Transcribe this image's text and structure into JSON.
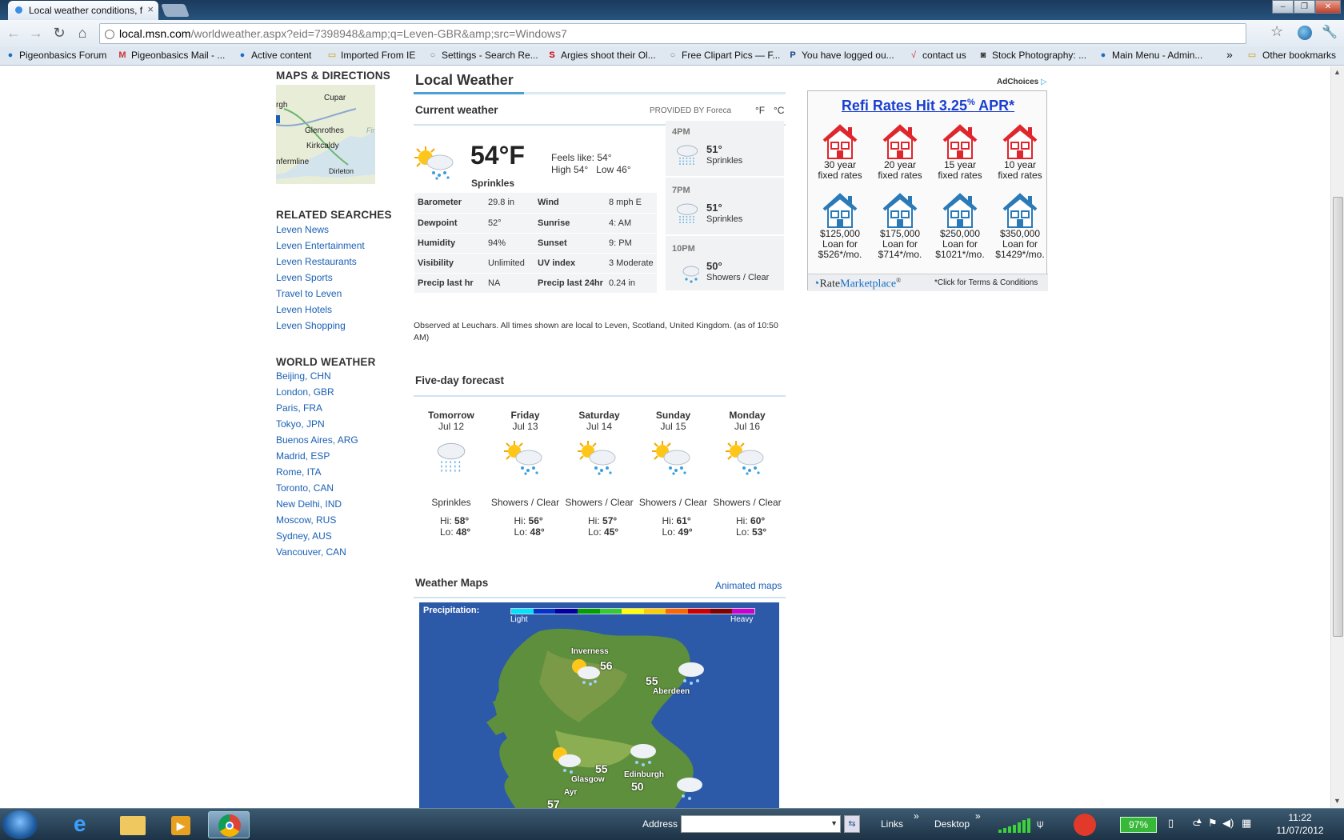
{
  "browser": {
    "tab_title": "Local weather conditions, f",
    "url_host": "local.msn.com",
    "url_path": "/worldweather.aspx?eid=7398948&amp;q=Leven-GBR&amp;src=Windows7",
    "bookmarks": [
      "Pigeonbasics Forum",
      "Pigeonbasics Mail - ...",
      "Active content",
      "Imported From IE",
      "Settings - Search Re...",
      "Argies shoot their Ol...",
      "Free Clipart Pics — F...",
      "You have logged ou...",
      "contact us",
      "Stock Photography: ...",
      "Main Menu - Admin..."
    ],
    "other_bookmarks": "Other bookmarks"
  },
  "sidebar": {
    "maps_heading": "MAPS & DIRECTIONS",
    "map_labels": [
      "Cupar",
      "Glenrothes",
      "Kirkcaldy",
      "Dirleton",
      "rgh",
      "nfermline",
      "Fir"
    ],
    "related_heading": "RELATED SEARCHES",
    "related": [
      "Leven News",
      "Leven Entertainment",
      "Leven Restaurants",
      "Leven Sports",
      "Travel to Leven",
      "Leven Hotels",
      "Leven Shopping"
    ],
    "world_heading": "WORLD WEATHER",
    "world": [
      "Beijing, CHN",
      "London, GBR",
      "Paris, FRA",
      "Tokyo, JPN",
      "Buenos Aires, ARG",
      "Madrid, ESP",
      "Rome, ITA",
      "Toronto, CAN",
      "New Delhi, IND",
      "Moscow, RUS",
      "Sydney, AUS",
      "Vancouver, CAN"
    ]
  },
  "weather": {
    "title": "Local Weather",
    "current_heading": "Current weather",
    "provided_by": "PROVIDED BY Foreca",
    "unit_f": "°F",
    "unit_c": "°C",
    "temp": "54°F",
    "condition": "Sprinkles",
    "feels": "Feels like: 54°",
    "hilo": "High 54°   Low 46°",
    "stats": [
      [
        "Barometer",
        "29.8 in",
        "Wind",
        "8 mph E"
      ],
      [
        "Dewpoint",
        "52°",
        "Sunrise",
        "4: AM"
      ],
      [
        "Humidity",
        "94%",
        "Sunset",
        "9: PM"
      ],
      [
        "Visibility",
        "Unlimited",
        "UV index",
        "3 Moderate"
      ],
      [
        "Precip last hr",
        "NA",
        "Precip last 24hr",
        "0.24 in"
      ]
    ],
    "hourly": [
      {
        "time": "4PM",
        "temp": "51°",
        "cond": "Sprinkles",
        "icon": "rain-icon"
      },
      {
        "time": "7PM",
        "temp": "51°",
        "cond": "Sprinkles",
        "icon": "rain-icon"
      },
      {
        "time": "10PM",
        "temp": "50°",
        "cond": "Showers / Clear",
        "icon": "moon-showers-icon"
      }
    ],
    "observed": "Observed at Leuchars. All times shown are local to Leven, Scotland, United Kingdom. (as of 10:50 AM)"
  },
  "forecast": {
    "heading": "Five-day forecast",
    "hi_label": "Hi:",
    "lo_label": "Lo:",
    "days": [
      {
        "name": "Tomorrow",
        "date": "Jul 12",
        "cond": "Sprinkles",
        "hi": "58°",
        "lo": "48°",
        "icon": "rain-icon"
      },
      {
        "name": "Friday",
        "date": "Jul 13",
        "cond": "Showers / Clear",
        "hi": "56°",
        "lo": "48°",
        "icon": "sun-showers-icon"
      },
      {
        "name": "Saturday",
        "date": "Jul 14",
        "cond": "Showers / Clear",
        "hi": "57°",
        "lo": "45°",
        "icon": "sun-showers-icon"
      },
      {
        "name": "Sunday",
        "date": "Jul 15",
        "cond": "Showers / Clear",
        "hi": "61°",
        "lo": "49°",
        "icon": "sun-showers-icon"
      },
      {
        "name": "Monday",
        "date": "Jul 16",
        "cond": "Showers / Clear",
        "hi": "60°",
        "lo": "53°",
        "icon": "sun-showers-icon"
      }
    ]
  },
  "maps": {
    "heading": "Weather Maps",
    "animated_link": "Animated maps",
    "precip_label": "Precipitation:",
    "light": "Light",
    "heavy": "Heavy",
    "legend_colors": [
      "#00e5ff",
      "#0033cc",
      "#0000a0",
      "#00a000",
      "#33cc33",
      "#ffff00",
      "#ffcc00",
      "#ff6600",
      "#cc0000",
      "#800000",
      "#cc00cc"
    ],
    "points": [
      {
        "city": "Inverness",
        "temp": "56"
      },
      {
        "city": "Aberdeen",
        "temp": "55"
      },
      {
        "city": "Glasgow",
        "temp": "55"
      },
      {
        "city": "Edinburgh",
        "temp": "50"
      },
      {
        "city": "Ayr",
        "temp": "57"
      }
    ]
  },
  "ad": {
    "adchoices": "AdChoices",
    "headline_a": "Refi Rates Hit ",
    "headline_rate": "3.25",
    "headline_pct": "%",
    "headline_b": " APR*",
    "top": [
      [
        "30 year",
        "fixed rates"
      ],
      [
        "20 year",
        "fixed rates"
      ],
      [
        "15 year",
        "fixed rates"
      ],
      [
        "10 year",
        "fixed rates"
      ]
    ],
    "bottom": [
      [
        "$125,000",
        "Loan for",
        "$526*/mo."
      ],
      [
        "$175,000",
        "Loan for",
        "$714*/mo."
      ],
      [
        "$250,000",
        "Loan for",
        "$1021*/mo."
      ],
      [
        "$350,000",
        "Loan for",
        "$1429*/mo."
      ]
    ],
    "brand_a": "Rate",
    "brand_b": "Marketplace",
    "brand_mark": "®",
    "terms": "*Click for Terms & Conditions"
  },
  "taskbar": {
    "address_label": "Address",
    "links_label": "Links",
    "desktop_label": "Desktop",
    "battery": "97%",
    "time": "11:22",
    "date": "11/07/2012"
  }
}
